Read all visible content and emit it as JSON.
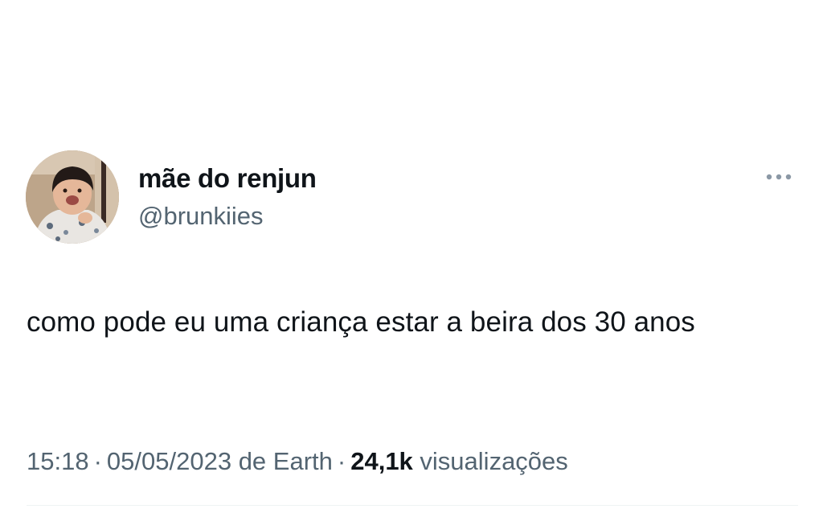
{
  "author": {
    "display_name": "mãe do renjun",
    "handle": "@brunkiies",
    "avatar_icon": "child-photo-avatar"
  },
  "more_icon": "more-horizontal-icon",
  "tweet": {
    "text": "como pode eu uma criança estar a beira dos 30 anos"
  },
  "meta": {
    "time": "15:18",
    "separator": "·",
    "date": "05/05/2023",
    "source": "de Earth",
    "views_count": "24,1k",
    "views_label": "visualizações"
  },
  "colors": {
    "text_primary": "#0f1419",
    "text_secondary": "#536471",
    "icon_gray": "#8b98a5",
    "background": "#ffffff"
  }
}
